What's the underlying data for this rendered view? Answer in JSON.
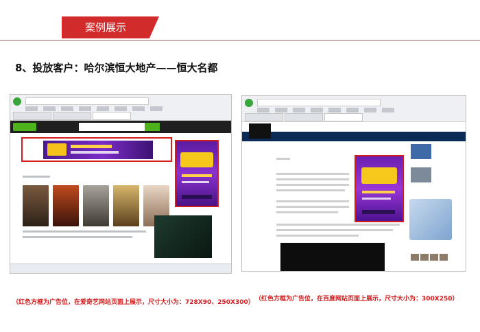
{
  "banner": {
    "title": "案例展示"
  },
  "heading": "8、投放客户：哈尔滨恒大地产——恒大名都",
  "captions": {
    "left": "（红色方框为广告位，在爱奇艺网站页面上展示，尺寸大小为：728X90、250X300）",
    "right": "（红色方框为广告位，在百度网站页面上展示，尺寸大小为：300X250）"
  },
  "colors": {
    "accent": "#d22b2b",
    "ad_frame": "#d31c1c",
    "ad_purple": "#7a2cc7"
  }
}
